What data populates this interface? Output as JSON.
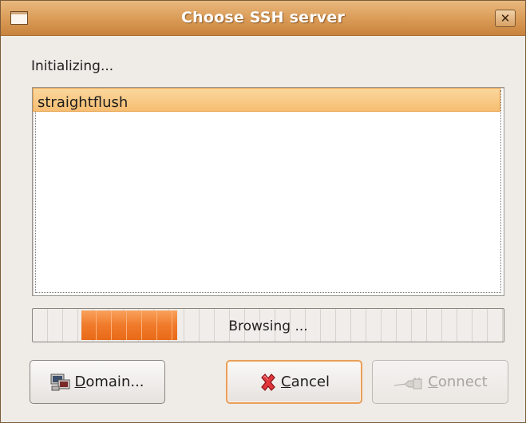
{
  "window": {
    "title": "Choose SSH server",
    "close_glyph": "✕"
  },
  "status": "Initializing...",
  "servers": [
    {
      "name": "straightflush",
      "selected": true
    }
  ],
  "progress": {
    "label": "Browsing ...",
    "mode": "pulse"
  },
  "buttons": {
    "domain": {
      "mnemonic": "D",
      "rest": "omain...",
      "icon": "network-domain-icon"
    },
    "cancel": {
      "mnemonic": "C",
      "rest": "ancel",
      "icon": "cancel-x-icon"
    },
    "connect": {
      "mnemonic": "C",
      "rest": "onnect",
      "icon": "connect-plug-icon",
      "enabled": false
    }
  },
  "colors": {
    "titlebar": "#d99a55",
    "selection": "#f6be72",
    "progress": "#f07a2a"
  }
}
